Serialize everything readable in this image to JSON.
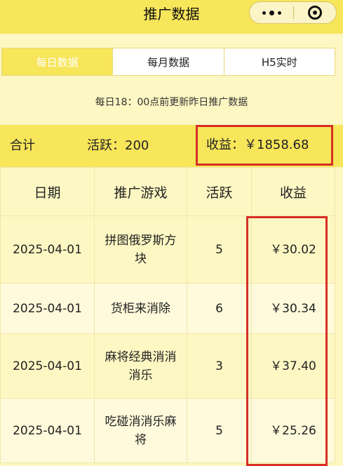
{
  "header": {
    "title": "推广数据"
  },
  "icons": {
    "more": "more-dots-icon",
    "close": "close-circle-icon"
  },
  "colors": {
    "brand_yellow": "#f7e55a",
    "background": "#fdf7c3",
    "highlight_red": "#d62e26"
  },
  "tabs": [
    {
      "label": "每日数据",
      "active": true
    },
    {
      "label": "每月数据",
      "active": false
    },
    {
      "label": "H5实时",
      "active": false
    }
  ],
  "notice": "每日18：00点前更新昨日推广数据",
  "summary": {
    "total_label": "合计",
    "active_text": "活跃：200",
    "income_text": "收益：￥1858.68"
  },
  "table": {
    "headers": [
      "日期",
      "推广游戏",
      "活跃",
      "收益"
    ],
    "rows": [
      {
        "date": "2025-04-01",
        "game": "拼图俄罗斯方块",
        "active": "5",
        "income": "￥30.02"
      },
      {
        "date": "2025-04-01",
        "game": "货柜来消除",
        "active": "6",
        "income": "￥30.34"
      },
      {
        "date": "2025-04-01",
        "game": "麻将经典消消消乐",
        "active": "3",
        "income": "￥37.40"
      },
      {
        "date": "2025-04-01",
        "game": "吃碰消消乐麻将",
        "active": "5",
        "income": "￥25.26"
      }
    ]
  }
}
